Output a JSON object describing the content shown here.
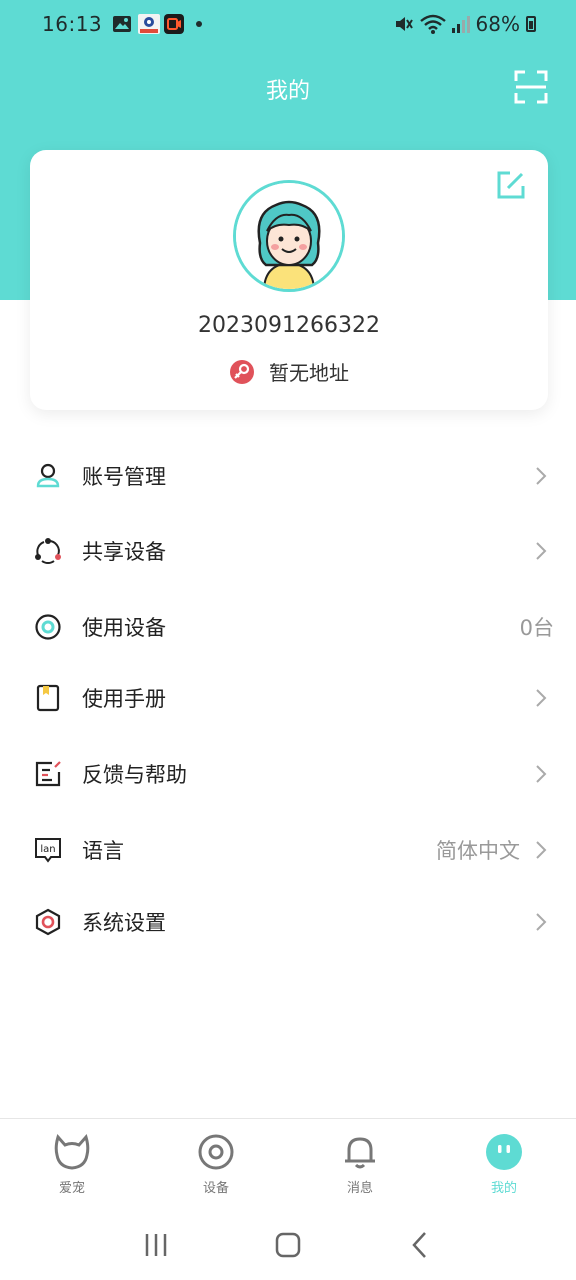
{
  "status_bar": {
    "time": "16:13",
    "battery": "68%"
  },
  "header": {
    "title": "我的"
  },
  "profile": {
    "user_id": "2023091266322",
    "address": "暂无地址"
  },
  "menu": {
    "items": [
      {
        "label": "账号管理",
        "value": ""
      },
      {
        "label": "共享设备",
        "value": ""
      },
      {
        "label": "使用设备",
        "value": "0台"
      },
      {
        "label": "使用手册",
        "value": ""
      },
      {
        "label": "反馈与帮助",
        "value": ""
      },
      {
        "label": "语言",
        "value": "简体中文"
      },
      {
        "label": "系统设置",
        "value": ""
      }
    ],
    "lan_icon_text": "lan"
  },
  "bottom_nav": {
    "items": [
      {
        "label": "爱宠",
        "icon": "pet-icon"
      },
      {
        "label": "设备",
        "icon": "device-icon"
      },
      {
        "label": "消息",
        "icon": "bell-icon"
      },
      {
        "label": "我的",
        "icon": "me-icon"
      }
    ],
    "active_index": 3
  },
  "colors": {
    "accent": "#5edbd3",
    "red": "#e0525a"
  }
}
